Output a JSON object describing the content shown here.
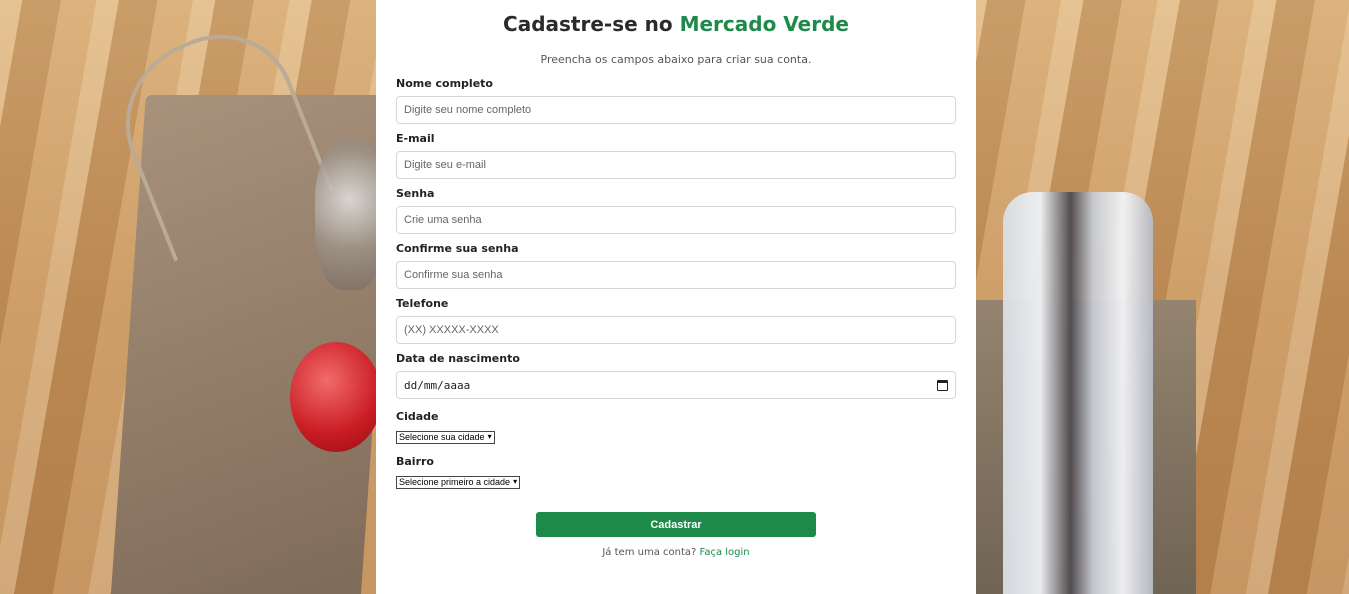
{
  "title": {
    "prefix": "Cadastre-se no",
    "brand": "Mercado Verde"
  },
  "subtitle": "Preencha os campos abaixo para criar sua conta.",
  "fields": {
    "name": {
      "label": "Nome completo",
      "placeholder": "Digite seu nome completo"
    },
    "email": {
      "label": "E-mail",
      "placeholder": "Digite seu e-mail"
    },
    "password": {
      "label": "Senha",
      "placeholder": "Crie uma senha"
    },
    "confirm": {
      "label": "Confirme sua senha",
      "placeholder": "Confirme sua senha"
    },
    "phone": {
      "label": "Telefone",
      "placeholder": "(XX) XXXXX-XXXX"
    },
    "birth": {
      "label": "Data de nascimento",
      "value": "dd/mm/aaaa"
    },
    "city": {
      "label": "Cidade",
      "selected": "Selecione sua cidade"
    },
    "neighborhood": {
      "label": "Bairro",
      "selected": "Selecione primeiro a cidade"
    }
  },
  "submit_label": "Cadastrar",
  "login": {
    "prompt": "Já tem uma conta?",
    "link": "Faça login"
  },
  "colors": {
    "brand": "#1e8a4a",
    "card": "#ffffff"
  },
  "icons": {
    "date": "calendar-icon",
    "select": "chevron-down-icon"
  }
}
